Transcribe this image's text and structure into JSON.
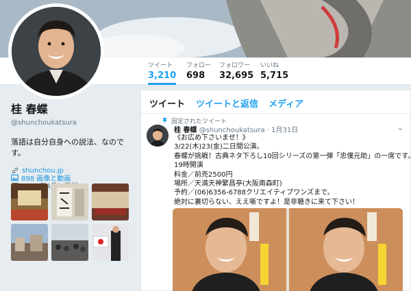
{
  "nav": {
    "stats": [
      {
        "label": "ツイート",
        "value": "3,210"
      },
      {
        "label": "フォロー",
        "value": "698"
      },
      {
        "label": "フォロワー",
        "value": "32,695"
      },
      {
        "label": "いいね",
        "value": "5,715"
      }
    ]
  },
  "profile": {
    "name": "桂 春蝶",
    "handle": "@shunchoukatsura",
    "bio": "落語は自分自身への説法、なのです。",
    "url": "shunchou.jp",
    "joined": "2015年4月に登録",
    "photos_label": "898 画像と動画"
  },
  "timeline": {
    "tabs": [
      "ツイート",
      "ツイートと返信",
      "メディア"
    ],
    "pinned_label": "固定されたツイート",
    "tweet": {
      "name": "桂 春蝶",
      "handle": "@shunchoukatsura",
      "date": "· 1月31日",
      "lines": [
        "《お広め下さいませ！》",
        "3/22(木)23(金)二日間公演。",
        "春蝶が挑戦！古典ネタ下ろし10回シリーズの第一弾「忠僕元助」の一席です。",
        "19時開演",
        "料金／前売2500円",
        "場所／天満天神繁昌亭(大阪南森町)",
        "予約／(06)6356-6788クリエイティブワンズまで。",
        "絶対に裏切らない、ええ噺ですよ！是非聴きに来て下さい！"
      ]
    }
  },
  "colors": {
    "accent": "#1da1f2",
    "link": "#1b95e0",
    "muted": "#657786",
    "poster": "#c88a58"
  }
}
